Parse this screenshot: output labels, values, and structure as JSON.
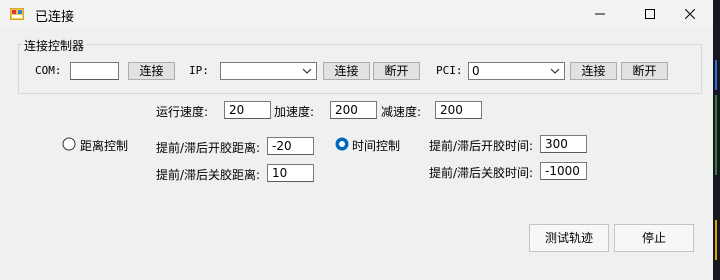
{
  "window": {
    "title": "已连接"
  },
  "group": {
    "title": "连接控制器"
  },
  "connection": {
    "com_label": "COM:",
    "com_value": "",
    "com_connect": "连接",
    "ip_label": "IP:",
    "ip_value": "",
    "ip_connect": "连接",
    "ip_disconnect": "断开",
    "pci_label": "PCI:",
    "pci_value": "0",
    "pci_connect": "连接",
    "pci_disconnect": "断开"
  },
  "motion": {
    "run_speed_label": "运行速度:",
    "run_speed": "20",
    "accel_label": "加速度:",
    "accel": "200",
    "decel_label": "减速度:",
    "decel": "200"
  },
  "distance_mode": {
    "label": "距离控制",
    "selected": false,
    "open_label": "提前/滞后开胶距离:",
    "open_value": "-20",
    "close_label": "提前/滞后关胶距离:",
    "close_value": "10"
  },
  "time_mode": {
    "label": "时间控制",
    "selected": true,
    "open_label": "提前/滞后开胶时间:",
    "open_value": "300",
    "close_label": "提前/滞后关胶时间:",
    "close_value": "-1000"
  },
  "actions": {
    "test_label": "测试轨迹",
    "stop_label": "停止"
  },
  "colors": {
    "accent": "#0067c0",
    "window_bg": "#f0f0f0"
  }
}
